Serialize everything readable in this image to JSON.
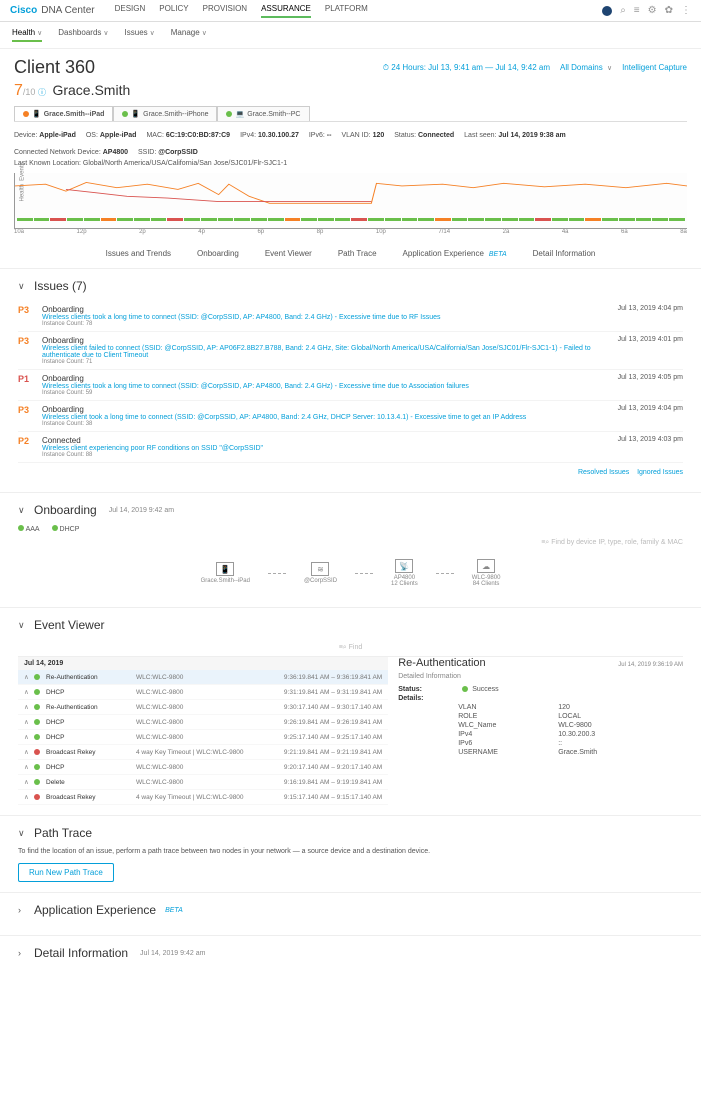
{
  "brand": {
    "logo": "Cisco",
    "sub": "DNA Center"
  },
  "topnav": [
    "DESIGN",
    "POLICY",
    "PROVISION",
    "ASSURANCE",
    "PLATFORM"
  ],
  "topnav_active": 3,
  "subnav": [
    "Health",
    "Dashboards",
    "Issues",
    "Manage"
  ],
  "subnav_active": 0,
  "page": {
    "title": "Client 360",
    "time_range": "24 Hours: Jul 13, 9:41 am — Jul 14, 9:42 am",
    "domains": "All Domains",
    "capture": "Intelligent Capture"
  },
  "client": {
    "score": "7",
    "score_max": "/10",
    "name": "Grace.Smith"
  },
  "client_tabs": [
    {
      "label": "Grace.Smith--iPad",
      "dot": "dot-orange",
      "active": true
    },
    {
      "label": "Grace.Smith--iPhone",
      "dot": "dot-green"
    },
    {
      "label": "Grace.Smith--PC",
      "dot": "dot-green"
    }
  ],
  "device_meta": [
    {
      "k": "Device:",
      "v": "Apple-iPad"
    },
    {
      "k": "OS:",
      "v": "Apple-iPad"
    },
    {
      "k": "MAC:",
      "v": "6C:19:C0:BD:87:C9"
    },
    {
      "k": "IPv4:",
      "v": "10.30.100.27"
    },
    {
      "k": "IPv6:",
      "v": "--"
    },
    {
      "k": "VLAN ID:",
      "v": "120"
    },
    {
      "k": "Status:",
      "v": "Connected"
    },
    {
      "k": "Last seen:",
      "v": "Jul 14, 2019 9:38 am"
    },
    {
      "k": "Connected Network Device:",
      "v": "AP4800"
    },
    {
      "k": "SSID:",
      "v": "@CorpSSID"
    }
  ],
  "location_line": "Last Known Location: Global/North America/USA/California/San Jose/SJC01/Flr-SJC1-1",
  "chart_x": [
    "10a",
    "12p",
    "2p",
    "4p",
    "6p",
    "8p",
    "10p",
    "7/14",
    "2a",
    "4a",
    "6a",
    "8a"
  ],
  "section_nav": [
    "Issues and Trends",
    "Onboarding",
    "Event Viewer",
    "Path Trace",
    "Application Experience",
    "Detail Information"
  ],
  "section_nav_beta": 4,
  "issues": {
    "title": "Issues (7)",
    "rows": [
      {
        "p": "P3",
        "pc": "p3",
        "cat": "Onboarding",
        "link": "Wireless clients took a long time to connect (SSID: @CorpSSID, AP: AP4800, Band: 2.4 GHz) - Excessive time due to RF Issues",
        "meta": "Instance Count: 78",
        "date": "Jul 13, 2019 4:04 pm"
      },
      {
        "p": "P3",
        "pc": "p3",
        "cat": "Onboarding",
        "link": "Wireless client failed to connect (SSID: @CorpSSID, AP: AP06F2.8B27.B788, Band: 2.4 GHz, Site: Global/North America/USA/California/San Jose/SJC01/Flr-SJC1-1) - Failed to authenticate due to Client Timeout",
        "meta": "Instance Count: 71",
        "date": "Jul 13, 2019 4:01 pm"
      },
      {
        "p": "P1",
        "pc": "p1",
        "cat": "Onboarding",
        "link": "Wireless clients took a long time to connect (SSID: @CorpSSID, AP: AP4800, Band: 2.4 GHz) - Excessive time due to Association failures",
        "meta": "Instance Count: 59",
        "date": "Jul 13, 2019 4:05 pm"
      },
      {
        "p": "P3",
        "pc": "p3",
        "cat": "Onboarding",
        "link": "Wireless client took a long time to connect (SSID: @CorpSSID, AP: AP4800, Band: 2.4 GHz, DHCP Server: 10.13.4.1) - Excessive time to get an IP Address",
        "meta": "Instance Count: 38",
        "date": "Jul 13, 2019 4:04 pm"
      },
      {
        "p": "P2",
        "pc": "p2",
        "cat": "Connected",
        "link": "Wireless client experiencing poor RF conditions on SSID \"@CorpSSID\"",
        "meta": "Instance Count: 88",
        "date": "Jul 13, 2019 4:03 pm"
      }
    ],
    "footer": {
      "resolved": "Resolved Issues",
      "ignored": "Ignored Issues"
    }
  },
  "onboarding": {
    "title": "Onboarding",
    "ts": "Jul 14, 2019 9:42 am",
    "legend": [
      "AAA",
      "DHCP"
    ],
    "search_ph": "Find by device IP, type, role, family & MAC",
    "nodes": [
      "Grace.Smith--iPad",
      "@CorpSSID",
      "AP4800",
      "WLC-9800"
    ],
    "node_sub": [
      "",
      "",
      "12 Clients",
      "84 Clients"
    ]
  },
  "event_viewer": {
    "title": "Event Viewer",
    "search_ph": "Find",
    "date_head": "Jul 14, 2019",
    "rows": [
      {
        "sel": true,
        "exp": "∧",
        "dot": "seg-g",
        "name": "Re-Authentication",
        "dom": "WLC:WLC-9800",
        "time": "9:36:19.841 AM – 9:36:19.841 AM"
      },
      {
        "exp": "∧",
        "dot": "seg-g",
        "name": "DHCP",
        "dom": "WLC:WLC-9800",
        "time": "9:31:19.841 AM – 9:31:19.841 AM"
      },
      {
        "exp": "∧",
        "dot": "seg-g",
        "name": "Re-Authentication",
        "dom": "WLC:WLC-9800",
        "time": "9:30:17.140 AM – 9:30:17.140 AM"
      },
      {
        "exp": "∧",
        "dot": "seg-g",
        "name": "DHCP",
        "dom": "WLC:WLC-9800",
        "time": "9:26:19.841 AM – 9:26:19.841 AM"
      },
      {
        "exp": "∧",
        "dot": "seg-g",
        "name": "DHCP",
        "dom": "WLC:WLC-9800",
        "time": "9:25:17.140 AM – 9:25:17.140 AM"
      },
      {
        "exp": "∧",
        "dot": "seg-r",
        "name": "Broadcast Rekey",
        "dom": "4 way Key Timeout | WLC:WLC-9800",
        "time": "9:21:19.841 AM – 9:21:19.841 AM"
      },
      {
        "exp": "∧",
        "dot": "seg-g",
        "name": "DHCP",
        "dom": "WLC:WLC-9800",
        "time": "9:20:17.140 AM – 9:20:17.140 AM"
      },
      {
        "exp": "∧",
        "dot": "seg-g",
        "name": "Delete",
        "dom": "WLC:WLC-9800",
        "time": "9:16:19.841 AM – 9:19:19.841 AM"
      },
      {
        "exp": "∧",
        "dot": "seg-r",
        "name": "Broadcast Rekey",
        "dom": "4 way Key Timeout | WLC:WLC-9800",
        "time": "9:15:17.140 AM – 9:15:17.140 AM"
      }
    ],
    "detail": {
      "title": "Re-Authentication",
      "ts": "Jul 14, 2019 9:36:19 AM",
      "sub": "Detailed Information",
      "status_k": "Status:",
      "status_v": "Success",
      "details_k": "Details:",
      "kv": [
        {
          "k": "VLAN",
          "v": "120"
        },
        {
          "k": "ROLE",
          "v": "LOCAL"
        },
        {
          "k": "WLC_Name",
          "v": "WLC-9800"
        },
        {
          "k": "IPv4",
          "v": "10.30.200.3"
        },
        {
          "k": "IPv6",
          "v": "::"
        },
        {
          "k": "USERNAME",
          "v": "Grace.Smith"
        }
      ]
    }
  },
  "path_trace": {
    "title": "Path Trace",
    "desc": "To find the location of an issue, perform a path trace between two nodes in your network — a source device and a destination device.",
    "btn": "Run New Path Trace"
  },
  "app_exp": {
    "title": "Application Experience",
    "beta": "BETA"
  },
  "detail_info": {
    "title": "Detail Information",
    "ts": "Jul 14, 2019 9:42 am"
  }
}
